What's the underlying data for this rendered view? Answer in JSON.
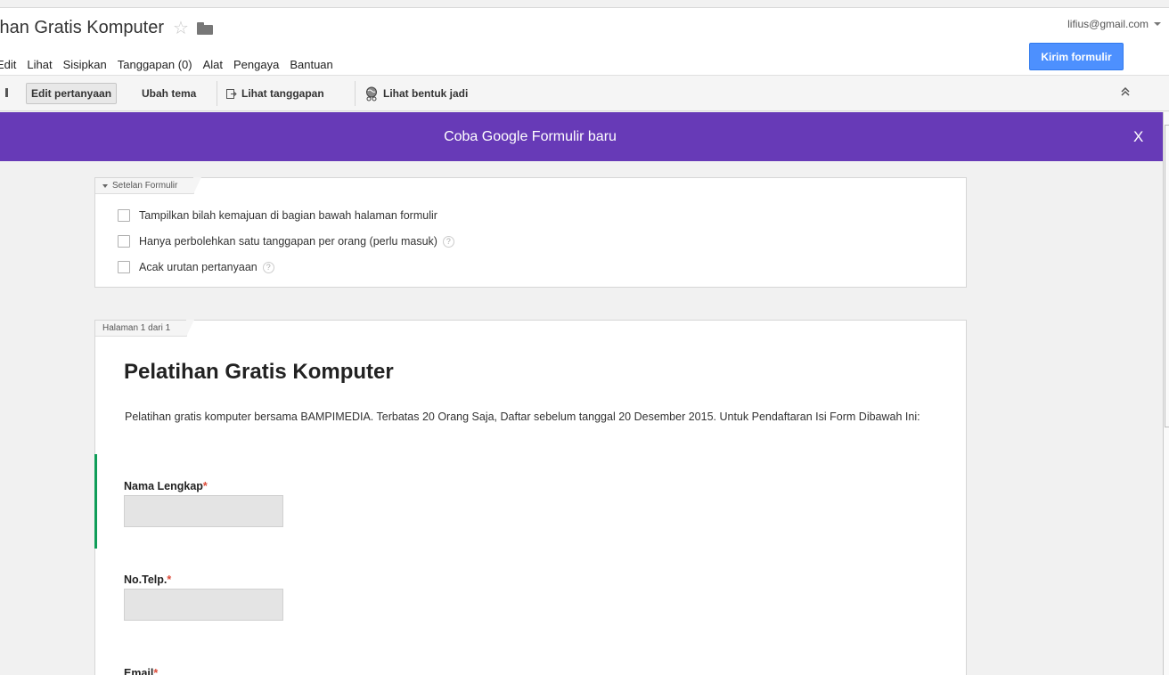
{
  "header": {
    "doc_title": "ihan Gratis Komputer",
    "menu": [
      "Edit",
      "Lihat",
      "Sisipkan",
      "Tanggapan (0)",
      "Alat",
      "Pengaya",
      "Bantuan"
    ],
    "account": "lifius@gmail.com",
    "send_label": "Kirim formulir"
  },
  "toolbar": {
    "edit_label": "Edit pertanyaan",
    "theme_label": "Ubah tema",
    "responses_label": "Lihat tanggapan",
    "live_label": "Lihat bentuk jadi"
  },
  "banner": {
    "text": "Coba Google Formulir baru",
    "close": "X",
    "color": "#673ab7"
  },
  "settings": {
    "tab": "Setelan Formulir",
    "options": [
      "Tampilkan bilah kemajuan di bagian bawah halaman formulir",
      "Hanya perbolehkan satu tanggapan per orang (perlu masuk)",
      "Acak urutan pertanyaan"
    ],
    "help": "?"
  },
  "page": {
    "tab": "Halaman 1 dari 1",
    "title": "Pelatihan Gratis Komputer",
    "description": "Pelatihan gratis komputer bersama BAMPIMEDIA. Terbatas 20 Orang Saja, Daftar sebelum tanggal 20 Desember 2015. Untuk Pendaftaran Isi Form Dibawah Ini:",
    "questions": [
      {
        "label": "Nama Lengkap",
        "required": "*"
      },
      {
        "label": "No.Telp.",
        "required": "*"
      },
      {
        "label": "Email",
        "required": "*"
      }
    ]
  },
  "colors": {
    "accent_blue": "#4d90fe",
    "active_green": "#0f9d58"
  }
}
